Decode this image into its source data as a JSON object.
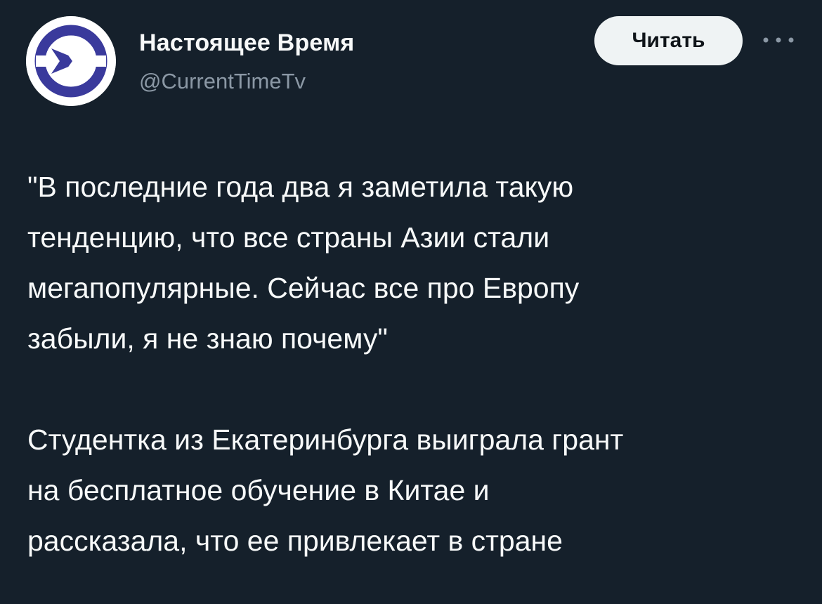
{
  "account": {
    "display_name": "Настоящее Время",
    "handle": "@CurrentTimeTv",
    "avatar_icon": "current-time-logo-icon",
    "brand_color": "#3a3a9c"
  },
  "actions": {
    "follow_label": "Читать",
    "more_icon": "more-dots-icon"
  },
  "tweet": {
    "paragraph1": [
      "\"В последние года два я заметила такую",
      "тенденцию, что все страны Азии стали",
      "мегапопулярные. Сейчас все про Европу",
      "забыли, я не знаю почему\""
    ],
    "paragraph2": [
      "Студентка из Екатеринбурга выиграла грант",
      "на бесплатное обучение в Китае и",
      "рассказала, что ее привлекает в стране"
    ]
  },
  "colors": {
    "background": "#15202b",
    "text": "#f7f9f9",
    "secondary_text": "#8b98a5",
    "button_bg": "#eff3f4"
  }
}
